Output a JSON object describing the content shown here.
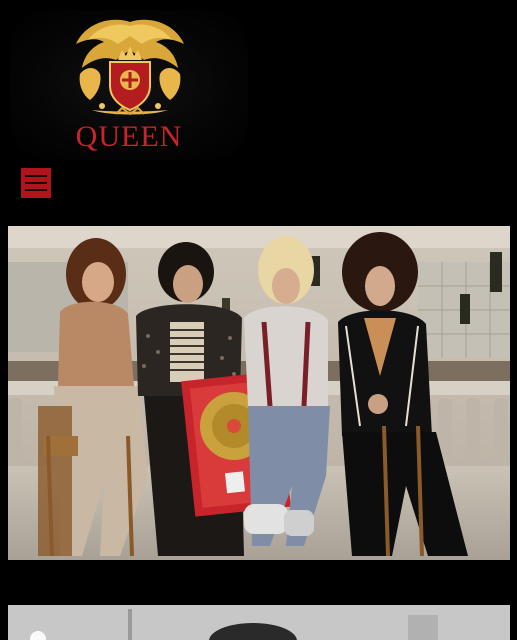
{
  "header": {
    "brand_name": "QUEEN",
    "logo_icon": "queen-crest-icon",
    "menu_icon": "hamburger-menu-icon"
  },
  "hero": {
    "image": "band-photo-with-gold-record"
  },
  "colors": {
    "background": "#000000",
    "brand_red": "#c8242c",
    "menu_red": "#b3141b"
  }
}
